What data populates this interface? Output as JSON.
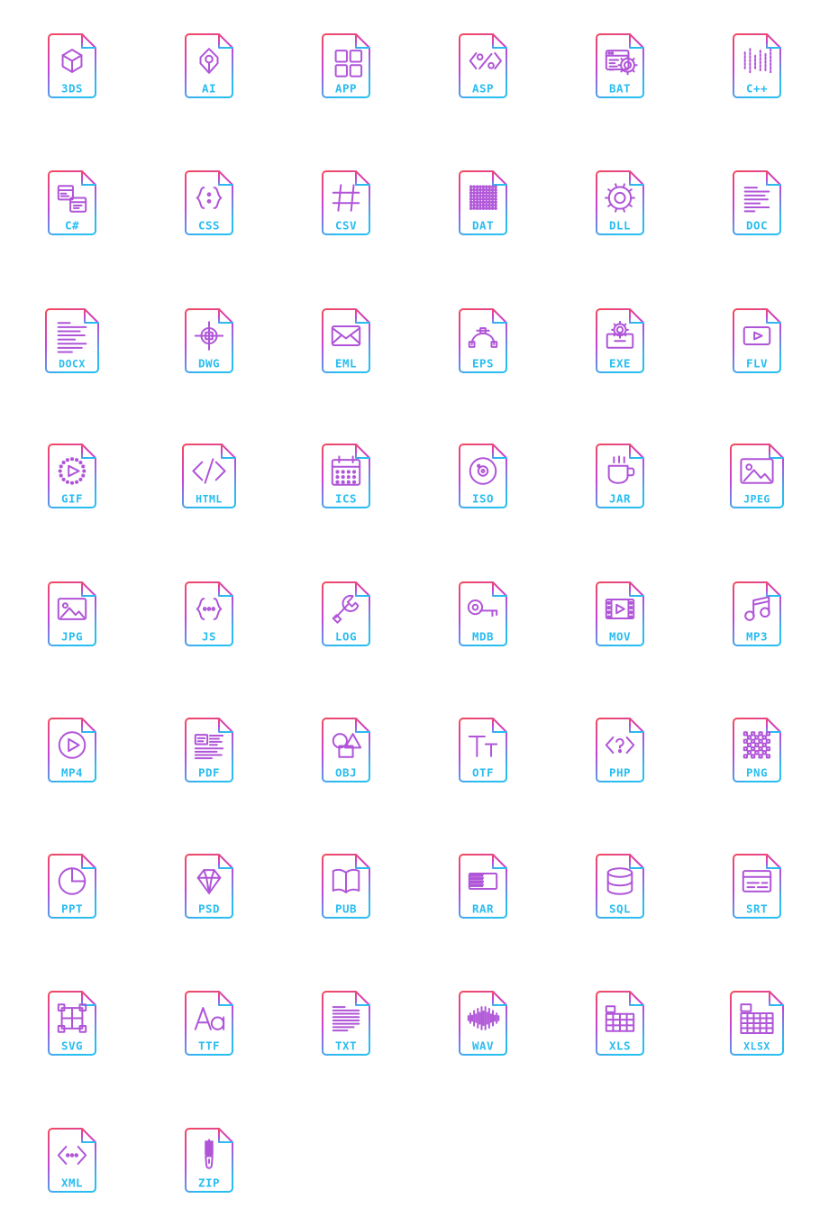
{
  "page": {
    "title": "File Type Icon Set",
    "background_color": "#ffffff",
    "columns": 6,
    "rows": 9,
    "total_icons": 50
  },
  "palette": {
    "gradient_top": "#f4495d",
    "gradient_mid": "#c742d6",
    "gradient_bottom": "#29bdf0",
    "label_color": "#29bdf0",
    "glyph_color": "#b055d8"
  },
  "icons": [
    {
      "label": "3DS",
      "glyph": "cube-icon",
      "row": 0,
      "col": 0
    },
    {
      "label": "AI",
      "glyph": "pen-nib-icon",
      "row": 0,
      "col": 1
    },
    {
      "label": "APP",
      "glyph": "app-grid-icon",
      "row": 0,
      "col": 2
    },
    {
      "label": "ASP",
      "glyph": "angle-percent-icon",
      "row": 0,
      "col": 3
    },
    {
      "label": "BAT",
      "glyph": "terminal-gear-icon",
      "row": 0,
      "col": 4
    },
    {
      "label": "C++",
      "glyph": "code-bars-icon",
      "row": 0,
      "col": 5
    },
    {
      "label": "C#",
      "glyph": "two-windows-icon",
      "row": 1,
      "col": 0
    },
    {
      "label": "CSS",
      "glyph": "braces-colon-icon",
      "row": 1,
      "col": 1
    },
    {
      "label": "CSV",
      "glyph": "hash-grid-icon",
      "row": 1,
      "col": 2
    },
    {
      "label": "DAT",
      "glyph": "dot-matrix-icon",
      "row": 1,
      "col": 3
    },
    {
      "label": "DLL",
      "glyph": "gear-icon",
      "row": 1,
      "col": 4
    },
    {
      "label": "DOC",
      "glyph": "text-lines-icon",
      "row": 1,
      "col": 5
    },
    {
      "label": "DOCX",
      "glyph": "text-paragraph-icon",
      "row": 2,
      "col": 0
    },
    {
      "label": "DWG",
      "glyph": "crosshair-icon",
      "row": 2,
      "col": 1
    },
    {
      "label": "EML",
      "glyph": "envelope-icon",
      "row": 2,
      "col": 2
    },
    {
      "label": "EPS",
      "glyph": "bezier-curve-icon",
      "row": 2,
      "col": 3
    },
    {
      "label": "EXE",
      "glyph": "gear-box-icon",
      "row": 2,
      "col": 4
    },
    {
      "label": "FLV",
      "glyph": "play-rect-icon",
      "row": 2,
      "col": 5
    },
    {
      "label": "GIF",
      "glyph": "play-dashed-icon",
      "row": 3,
      "col": 0
    },
    {
      "label": "HTML",
      "glyph": "code-tag-icon",
      "row": 3,
      "col": 1
    },
    {
      "label": "ICS",
      "glyph": "calendar-icon",
      "row": 3,
      "col": 2
    },
    {
      "label": "ISO",
      "glyph": "disc-icon",
      "row": 3,
      "col": 3
    },
    {
      "label": "JAR",
      "glyph": "coffee-cup-icon",
      "row": 3,
      "col": 4
    },
    {
      "label": "JPEG",
      "glyph": "image-mountain-icon",
      "row": 3,
      "col": 5
    },
    {
      "label": "JPG",
      "glyph": "image-mountain-icon",
      "row": 4,
      "col": 0
    },
    {
      "label": "JS",
      "glyph": "braces-dots-icon",
      "row": 4,
      "col": 1
    },
    {
      "label": "LOG",
      "glyph": "wrench-icon",
      "row": 4,
      "col": 2
    },
    {
      "label": "MDB",
      "glyph": "key-icon",
      "row": 4,
      "col": 3
    },
    {
      "label": "MOV",
      "glyph": "film-strip-icon",
      "row": 4,
      "col": 4
    },
    {
      "label": "MP3",
      "glyph": "music-note-icon",
      "row": 4,
      "col": 5
    },
    {
      "label": "MP4",
      "glyph": "play-circle-icon",
      "row": 5,
      "col": 0
    },
    {
      "label": "PDF",
      "glyph": "doc-columns-icon",
      "row": 5,
      "col": 1
    },
    {
      "label": "OBJ",
      "glyph": "shapes-icon",
      "row": 5,
      "col": 2
    },
    {
      "label": "OTF",
      "glyph": "typography-tt-icon",
      "row": 5,
      "col": 3
    },
    {
      "label": "PHP",
      "glyph": "tag-question-icon",
      "row": 5,
      "col": 4
    },
    {
      "label": "PNG",
      "glyph": "pixel-grid-icon",
      "row": 5,
      "col": 5
    },
    {
      "label": "PPT",
      "glyph": "pie-chart-icon",
      "row": 6,
      "col": 0
    },
    {
      "label": "PSD",
      "glyph": "diamond-icon",
      "row": 6,
      "col": 1
    },
    {
      "label": "PUB",
      "glyph": "open-book-icon",
      "row": 6,
      "col": 2
    },
    {
      "label": "RAR",
      "glyph": "zigzag-stack-icon",
      "row": 6,
      "col": 3
    },
    {
      "label": "SQL",
      "glyph": "database-icon",
      "row": 6,
      "col": 4
    },
    {
      "label": "SRT",
      "glyph": "subtitle-box-icon",
      "row": 6,
      "col": 5
    },
    {
      "label": "SVG",
      "glyph": "vector-nodes-icon",
      "row": 7,
      "col": 0
    },
    {
      "label": "TTF",
      "glyph": "font-aa-icon",
      "row": 7,
      "col": 1
    },
    {
      "label": "TXT",
      "glyph": "lines-icon",
      "row": 7,
      "col": 2
    },
    {
      "label": "WAV",
      "glyph": "waveform-icon",
      "row": 7,
      "col": 3
    },
    {
      "label": "XLS",
      "glyph": "table-grid-icon",
      "row": 7,
      "col": 4
    },
    {
      "label": "XLSX",
      "glyph": "table-grid-wide-icon",
      "row": 7,
      "col": 5
    },
    {
      "label": "XML",
      "glyph": "angle-dots-icon",
      "row": 8,
      "col": 0
    },
    {
      "label": "ZIP",
      "glyph": "zipper-icon",
      "row": 8,
      "col": 1
    }
  ]
}
